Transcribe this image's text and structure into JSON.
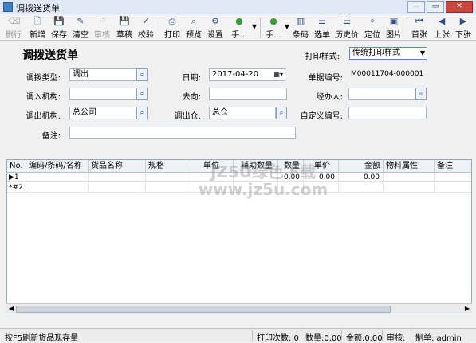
{
  "window": {
    "title": "调拨送货单",
    "buttons": [
      "—",
      "▭",
      "✕"
    ]
  },
  "toolbar": {
    "items": [
      {
        "label": "删行",
        "icon": "delete-row-icon",
        "glyph": "⌫",
        "enabled": false
      },
      {
        "label": "新增",
        "icon": "new-icon",
        "glyph": "🗋",
        "enabled": true
      },
      {
        "label": "保存",
        "icon": "save-icon",
        "glyph": "💾",
        "enabled": true
      },
      {
        "label": "清空",
        "icon": "clear-icon",
        "glyph": "✎",
        "enabled": true
      },
      {
        "label": "审核",
        "icon": "audit-icon",
        "glyph": "⚐",
        "enabled": false
      },
      {
        "label": "草稿",
        "icon": "draft-icon",
        "glyph": "💾",
        "enabled": true
      },
      {
        "label": "校验",
        "icon": "verify-icon",
        "glyph": "✓",
        "enabled": true
      },
      {
        "label": "打印",
        "icon": "print-icon",
        "glyph": "⎙",
        "enabled": true
      },
      {
        "label": "预览",
        "icon": "preview-icon",
        "glyph": "⌕",
        "enabled": true
      },
      {
        "label": "设置",
        "icon": "settings-icon",
        "glyph": "⚙",
        "enabled": true
      },
      {
        "label": "手...",
        "icon": "manual-icon",
        "glyph": "●",
        "enabled": true
      },
      {
        "label": "手...",
        "icon": "manual2-icon",
        "glyph": "●",
        "enabled": true
      },
      {
        "label": "条码",
        "icon": "barcode-icon",
        "glyph": "▥",
        "enabled": true
      },
      {
        "label": "选单",
        "icon": "select-order-icon",
        "glyph": "☰",
        "enabled": true
      },
      {
        "label": "历史价",
        "icon": "history-price-icon",
        "glyph": "☰",
        "enabled": true
      },
      {
        "label": "定位",
        "icon": "locate-icon",
        "glyph": "⌖",
        "enabled": true
      },
      {
        "label": "图片",
        "icon": "image-icon",
        "glyph": "▣",
        "enabled": true
      },
      {
        "label": "首张",
        "icon": "first-icon",
        "glyph": "⏮",
        "enabled": true
      },
      {
        "label": "上张",
        "icon": "prev-icon",
        "glyph": "◀",
        "enabled": true
      },
      {
        "label": "下张",
        "icon": "next-icon",
        "glyph": "▶",
        "enabled": true
      }
    ]
  },
  "form": {
    "doc_title": "调拨送货单",
    "print_style_label": "打印样式:",
    "print_style_value": "传统打印样式",
    "transfer_type_label": "调拨类型:",
    "transfer_type_value": "调出",
    "date_label": "日期:",
    "date_value": "2017-04-20",
    "doc_no_label": "单据编号:",
    "doc_no_value": "M00011704-000001",
    "in_org_label": "调入机构:",
    "in_org_value": "",
    "destination_label": "去向:",
    "destination_value": "",
    "handler_label": "经办人:",
    "handler_value": "",
    "out_org_label": "调出机构:",
    "out_org_value": "总公司",
    "out_warehouse_label": "调出仓:",
    "out_warehouse_value": "总仓",
    "custom_no_label": "自定义编号:",
    "custom_no_value": "",
    "remark_label": "备注:",
    "remark_value": ""
  },
  "grid": {
    "columns": [
      "No.",
      "编码/条码/名称",
      "货品名称",
      "规格",
      "单位",
      "辅助数量",
      "数量",
      "单价",
      "金额",
      "物料属性",
      "备注"
    ],
    "rows": [
      {
        "no": "▶1",
        "code": "",
        "name": "",
        "spec": "",
        "unit": "",
        "aux_qty": "",
        "qty": "0.00",
        "price": "0.00",
        "amount": "0.00",
        "material": "",
        "remark": ""
      },
      {
        "no": "*#2",
        "code": "",
        "name": "",
        "spec": "",
        "unit": "",
        "aux_qty": "",
        "qty": "",
        "price": "",
        "amount": "",
        "material": "",
        "remark": ""
      }
    ],
    "watermark_line1": "JZ5U绿色下载",
    "watermark_line2": "www.jz5u.com"
  },
  "status": {
    "hint": "按F5刷新货品现存量",
    "print_count": "打印次数: 0",
    "quantity": "数量:0.00",
    "amount": "金额:0.00",
    "auditor": "审核:",
    "maker": "制单: admin"
  }
}
